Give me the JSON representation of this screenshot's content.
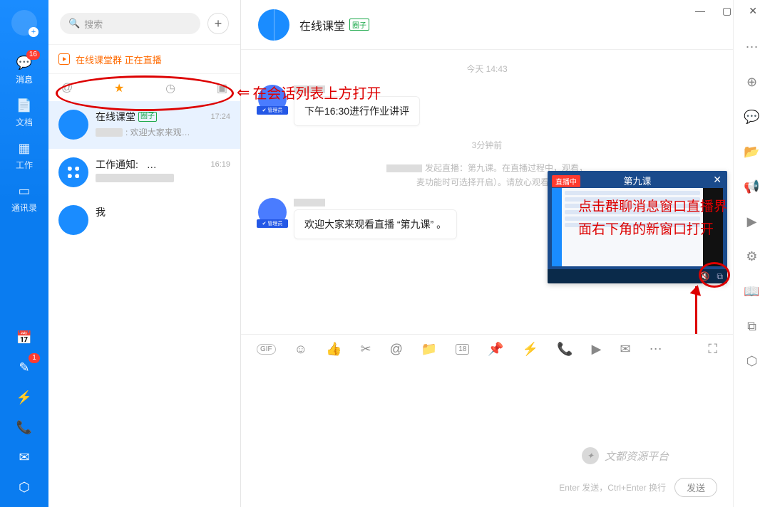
{
  "window": {
    "min": "—",
    "max": "▢",
    "close": "✕"
  },
  "rail": {
    "items": [
      {
        "label": "消息",
        "badge": "16"
      },
      {
        "label": "文档"
      },
      {
        "label": "工作"
      },
      {
        "label": "通讯录"
      }
    ],
    "bottomBadge": "1"
  },
  "search": {
    "placeholder": "搜索"
  },
  "liveBanner": {
    "text": "在线课堂群 正在直播"
  },
  "annotation1": "在会话列表上方打开",
  "annotation2a": "点击群聊消息窗口直播界",
  "annotation2b": "面右下角的新窗口打开",
  "filters": {
    "at": "@",
    "star": "★",
    "clock": "◷",
    "jar": "▣"
  },
  "conversations": [
    {
      "name": "在线课堂",
      "tag": "圈子",
      "time": "17:24",
      "preview": ": 欢迎大家来观…"
    },
    {
      "name": "工作通知:",
      "dots": "…",
      "time": "16:19",
      "preview": ""
    },
    {
      "name": "我",
      "time": "",
      "preview": ""
    }
  ],
  "chat": {
    "title": "在线课堂",
    "tag": "圈子",
    "ts1": "今天 14:43",
    "msg1": "下午16:30进行作业讲评",
    "ts2": "3分钟前",
    "sys": "发起直播：第九课。在直播过程中，观看，",
    "sys2": "麦功能时可选择开启）。请放心观看。",
    "msg2": "欢迎大家来观看直播 “第九课” 。"
  },
  "live": {
    "badge": "直播中",
    "title": "第九课",
    "close": "✕"
  },
  "compose": {
    "hint": "Enter 发送，Ctrl+Enter 换行",
    "send": "发送",
    "tools": {
      "gif": "GIF",
      "emoji": "☺",
      "like": "👍",
      "cut": "✂",
      "at": "@",
      "folder": "📁",
      "cal": "18",
      "pin": "📌",
      "bolt": "⚡",
      "phone": "📞",
      "video": "▶",
      "mail": "✉",
      "more": "⋯",
      "expand": "⛶"
    }
  },
  "rrail": [
    "⋯",
    "⊕",
    "💬",
    "📂",
    "📢",
    "▶",
    "⚙",
    "📖",
    "⧉",
    "⬡"
  ],
  "watermark": "文都资源平台"
}
